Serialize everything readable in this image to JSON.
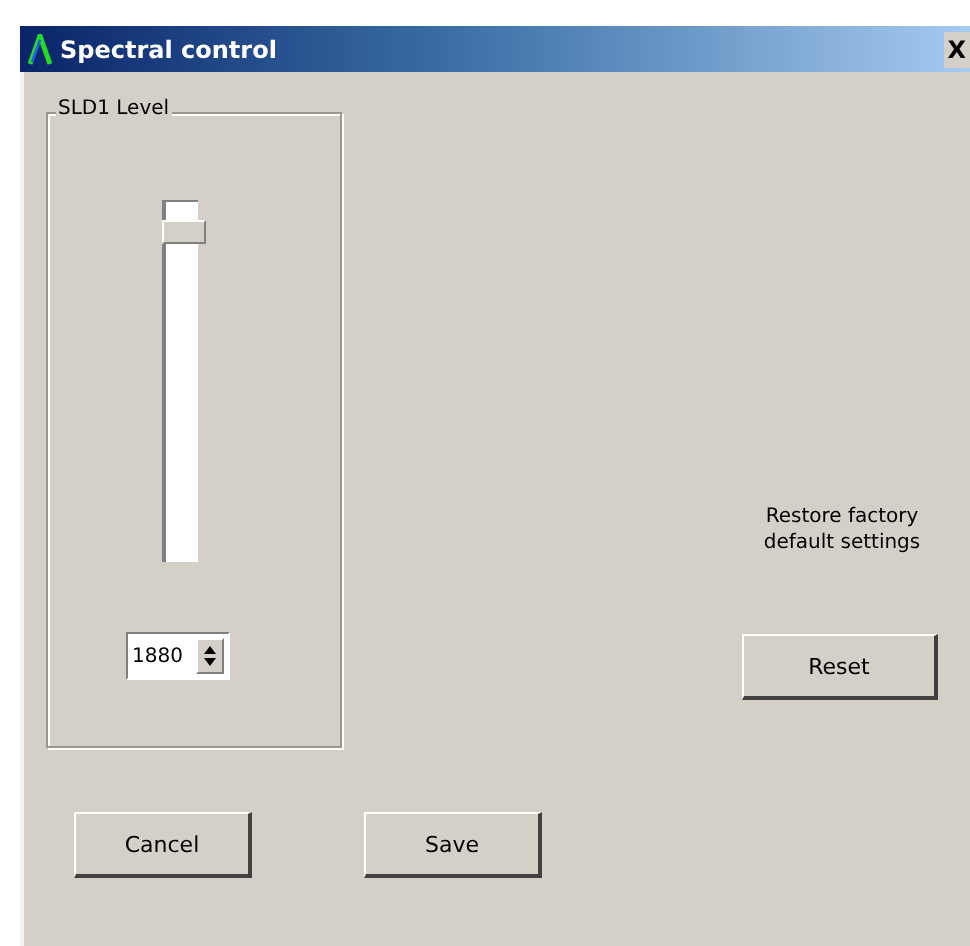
{
  "window": {
    "title": "Spectral control",
    "close": "X"
  },
  "group": {
    "title": "SLD1 Level",
    "slider": {
      "level": 0.95
    },
    "spin": {
      "value": "1880"
    }
  },
  "restore": {
    "text": "Restore factory default settings",
    "button": "Reset"
  },
  "buttons": [
    {
      "label": "Cancel"
    },
    {
      "label": "Save"
    }
  ]
}
